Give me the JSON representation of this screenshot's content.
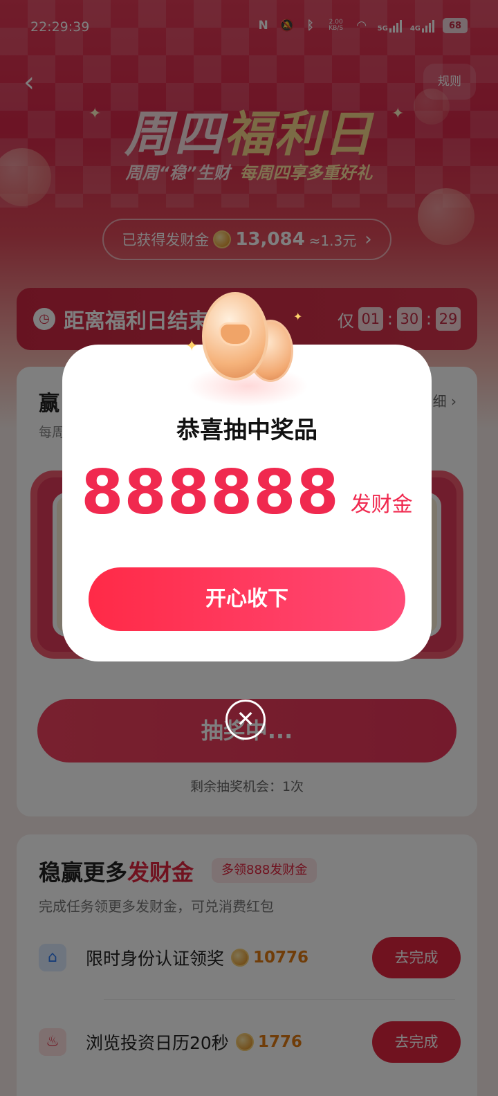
{
  "status_bar": {
    "time": "22:29:39",
    "net_speed_value": "2.00",
    "net_speed_unit": "KB/S",
    "signal_1": "5G",
    "signal_2": "4G",
    "battery": "68"
  },
  "header": {
    "rules_label": "规则",
    "title_part1": "周四",
    "title_part2": "福利日",
    "subtitle": "周周“稳”生财",
    "subtitle_highlight": "每周四享多重好礼",
    "earned_label": "已获得发财金",
    "earned_amount": "13,084",
    "earned_approx": "≈1.3元"
  },
  "countdown": {
    "label": "距离福利日结束",
    "only": "仅",
    "hours": "01",
    "minutes": "30",
    "seconds": "29",
    "sep": ":"
  },
  "lottery": {
    "title": "赢",
    "subtitle": "每周",
    "more": "细",
    "draw_button": "抽奖中...",
    "remaining": "剩余抽奖机会：1次"
  },
  "tasks": {
    "title_prefix": "稳赢更多",
    "title_highlight": "发财金",
    "badge": "多领888发财金",
    "subtitle": "完成任务领更多发财金，可兑消费红包",
    "items": [
      {
        "name": "限时身份认证领奖",
        "reward": "10776",
        "button": "去完成",
        "icon": "home-icon"
      },
      {
        "name": "浏览投资日历20秒",
        "reward": "1776",
        "button": "去完成",
        "icon": "fire-icon"
      }
    ]
  },
  "modal": {
    "title": "恭喜抽中奖品",
    "prize_amount": "888888",
    "prize_unit": "发财金",
    "accept_button": "开心收下"
  },
  "colors": {
    "brand_red": "#e0243f",
    "prize_red": "#f0294f",
    "reward_orange": "#e07a12"
  }
}
